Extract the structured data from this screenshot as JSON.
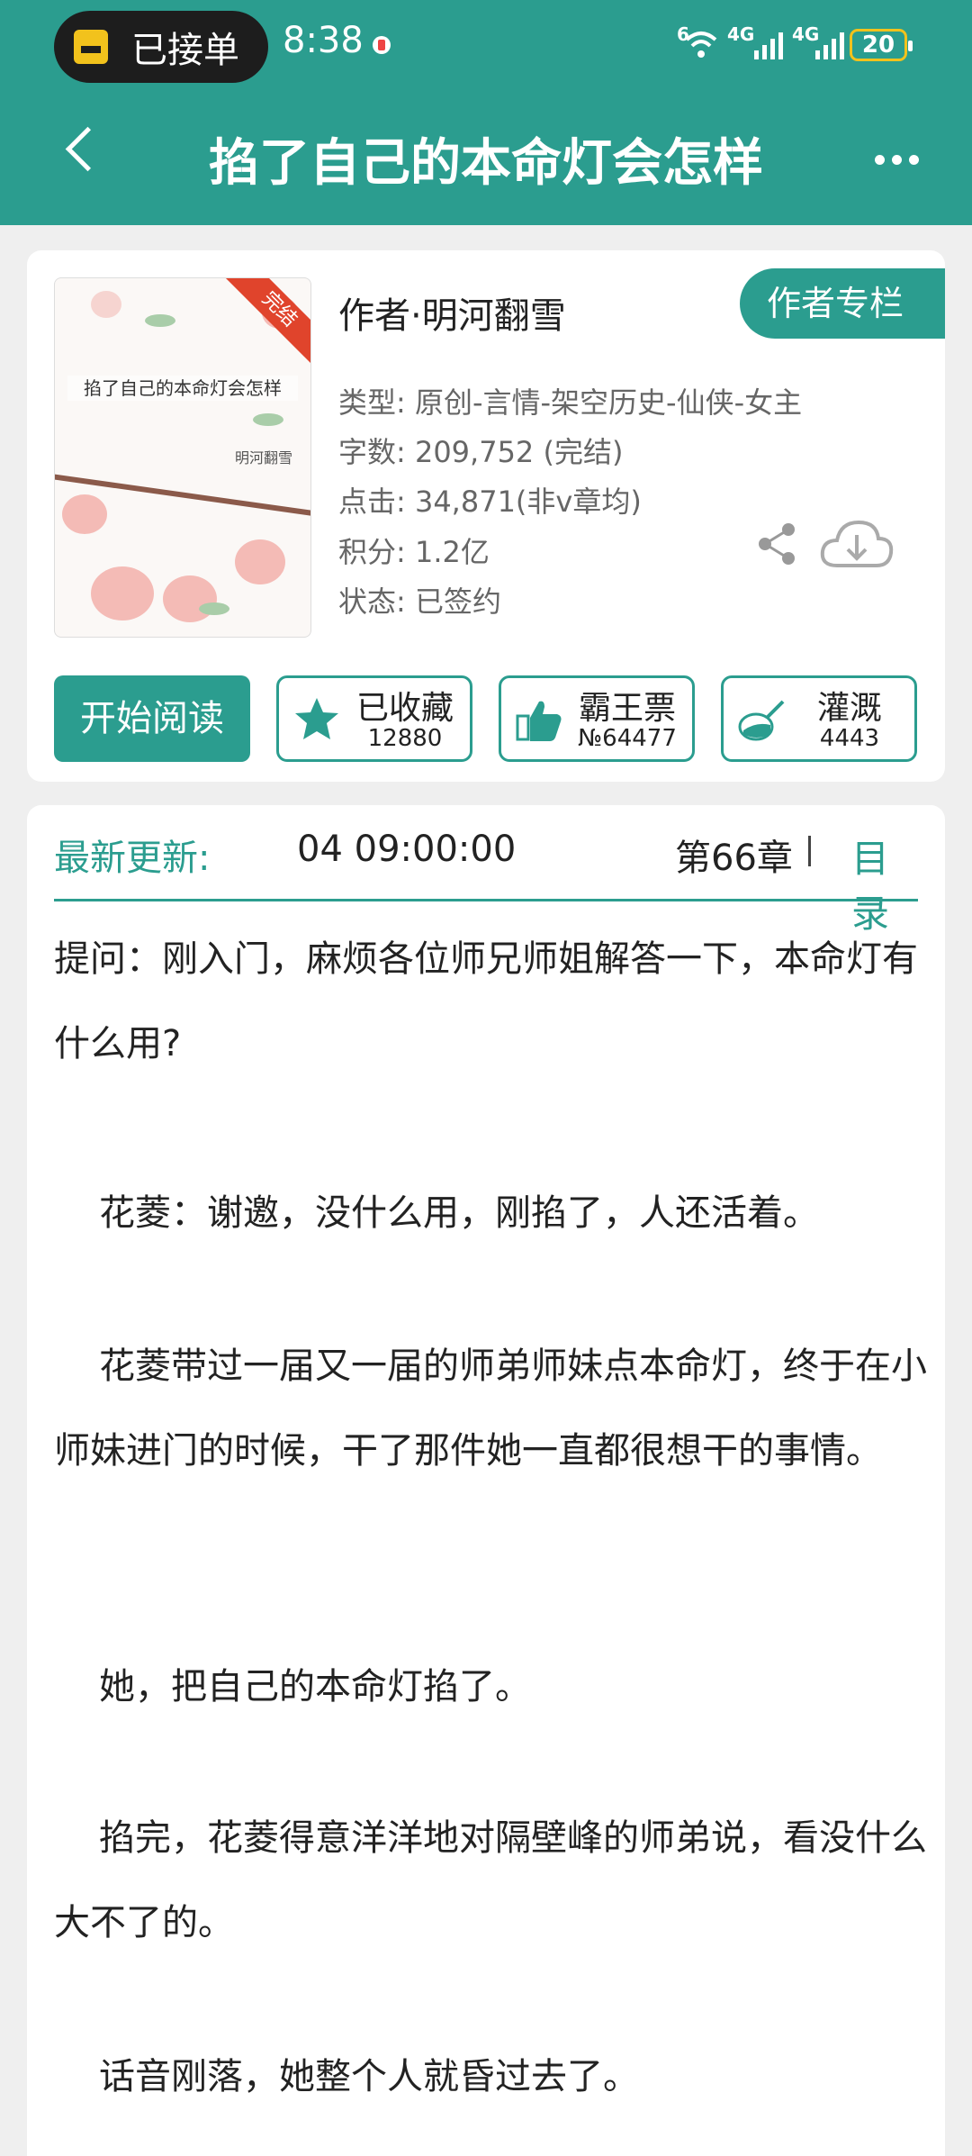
{
  "status": {
    "pill_label": "已接单",
    "time": "8:38",
    "net1_top": "6",
    "net2_top": "4G",
    "net3_top": "4G",
    "battery": "20"
  },
  "header": {
    "title": "掐了自己的本命灯会怎样"
  },
  "book": {
    "cover_title": "掐了自己的本命灯会怎样",
    "cover_author": "明河翻雪",
    "ribbon": "完结",
    "author_line": "作者·明河翻雪",
    "author_column_label": "作者专栏",
    "genre": "类型: 原创-言情-架空历史-仙侠-女主",
    "words": "字数: 209,752 (完结)",
    "clicks": "点击: 34,871(非v章均)",
    "score": "积分: 1.2亿",
    "state": "状态: 已签约"
  },
  "actions": {
    "read_label": "开始阅读",
    "favorite": {
      "label": "已收藏",
      "value": "12880"
    },
    "tickets": {
      "label": "霸王票",
      "value": "№64477"
    },
    "water": {
      "label": "灌溉",
      "value": "4443"
    }
  },
  "update": {
    "label": "最新更新:",
    "time": "04 09:00:00",
    "chapter": "第66章",
    "toc_label": "目录"
  },
  "content": {
    "p1": "提问：刚入门，麻烦各位师兄师姐解答一下，本命灯有什么用?",
    "p2": "花菱：谢邀，没什么用，刚掐了，人还活着。",
    "p3": "花菱带过一届又一届的师弟师妹点本命灯，终于在小师妹进门的时候，干了那件她一直都很想干的事情。",
    "p4": "她，把自己的本命灯掐了。",
    "p5": "掐完，花菱得意洋洋地对隔壁峰的师弟说，看没什么大不了的。",
    "p6": "话音刚落，她整个人就昏过去了。"
  },
  "colors": {
    "accent": "#2b9d8f",
    "ribbon": "#e0442c",
    "battery": "#f2c21c"
  }
}
